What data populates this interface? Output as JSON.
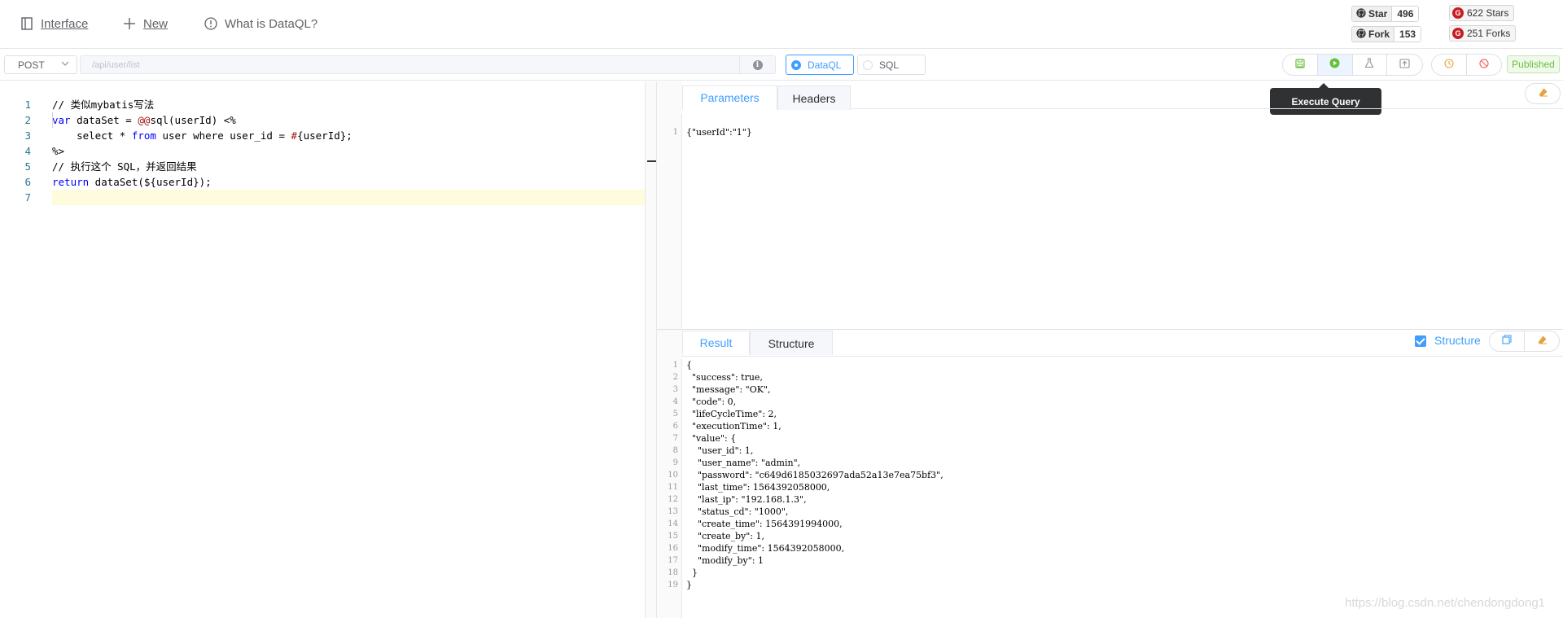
{
  "nav": {
    "interface_label": "Interface",
    "new_label": "New",
    "about_label": "What is DataQL?"
  },
  "badges": {
    "star_label": "Star",
    "star_count": "496",
    "fork_label": "Fork",
    "fork_count": "153",
    "gitee_stars": "622 Stars",
    "gitee_forks": "251 Forks"
  },
  "toolbar": {
    "method": "POST",
    "path_placeholder": "/api/user/list",
    "mode_dataql": "DataQL",
    "mode_sql": "SQL",
    "selected_mode": "DataQL",
    "status": "Published",
    "tooltip": "Execute Query",
    "buttons": [
      "save-icon",
      "execute-icon",
      "test-icon",
      "publish-icon",
      "history-icon",
      "disable-icon"
    ]
  },
  "editor": {
    "lines": [
      "// 类似mybatis写法",
      "var dataSet = @@sql(userId) <%",
      "    select * from user where user_id = #{userId};",
      "%>",
      "// 执行这个 SQL，并返回结果",
      "return dataSet(${userId});",
      ""
    ],
    "current_line": 7
  },
  "params_panel": {
    "tabs": [
      "Parameters",
      "Headers"
    ],
    "active_tab": "Parameters",
    "lines": [
      "{\"userId\":\"1\"}"
    ]
  },
  "result_panel": {
    "tabs": [
      "Result",
      "Structure"
    ],
    "active_tab": "Result",
    "structure_checkbox_label": "Structure",
    "structure_checked": true,
    "lines": [
      "{",
      "  \"success\": true,",
      "  \"message\": \"OK\",",
      "  \"code\": 0,",
      "  \"lifeCycleTime\": 2,",
      "  \"executionTime\": 1,",
      "  \"value\": {",
      "    \"user_id\": 1,",
      "    \"user_name\": \"admin\",",
      "    \"password\": \"c649d6185032697ada52a13e7ea75bf3\",",
      "    \"last_time\": 1564392058000,",
      "    \"last_ip\": \"192.168.1.3\",",
      "    \"status_cd\": \"1000\",",
      "    \"create_time\": 1564391994000,",
      "    \"create_by\": 1,",
      "    \"modify_time\": 1564392058000,",
      "    \"modify_by\": 1",
      "  }",
      "}"
    ]
  },
  "watermark": "https://blog.csdn.net/chendongdong1",
  "colors": {
    "accent": "#409eff",
    "success": "#67c23a",
    "danger": "#f56c6c",
    "warning": "#e6a23c",
    "gitee_red": "#c71d23"
  }
}
